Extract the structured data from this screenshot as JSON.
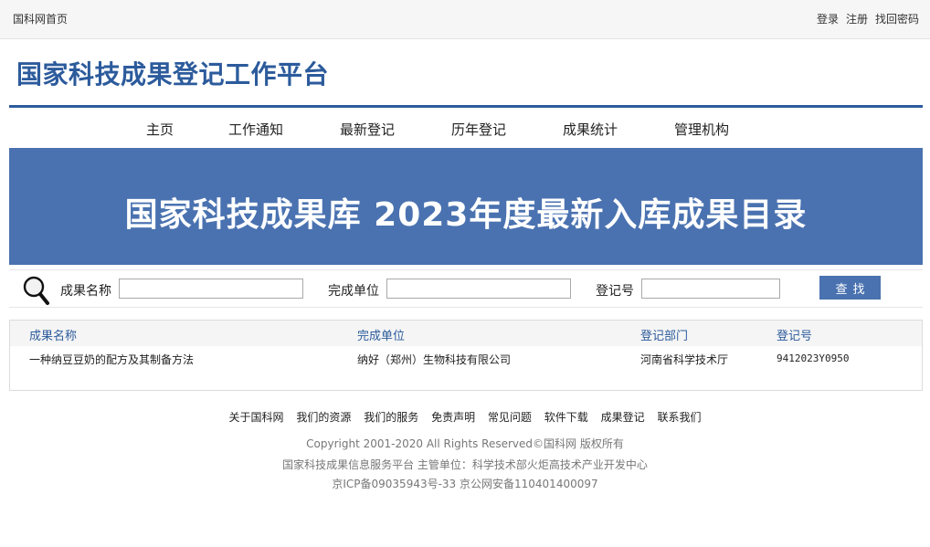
{
  "topbar": {
    "home": "国科网首页",
    "login": "登录",
    "register": "注册",
    "recover": "找回密码"
  },
  "header": {
    "title": "国家科技成果登记工作平台"
  },
  "nav": {
    "items": [
      "主页",
      "工作通知",
      "最新登记",
      "历年登记",
      "成果统计",
      "管理机构"
    ]
  },
  "banner": {
    "title": "国家科技成果库 2023年度最新入库成果目录"
  },
  "search": {
    "label_name": "成果名称",
    "label_unit": "完成单位",
    "label_reg": "登记号",
    "value_name": "",
    "value_unit": "",
    "value_reg": "",
    "button": "查找"
  },
  "results": {
    "headers": [
      "成果名称",
      "完成单位",
      "登记部门",
      "登记号"
    ],
    "rows": [
      [
        "一种纳豆豆奶的配方及其制备方法",
        "纳好（郑州）生物科技有限公司",
        "河南省科学技术厅",
        "9412023Y0950"
      ]
    ]
  },
  "footer": {
    "links": [
      "关于国科网",
      "我们的资源",
      "我们的服务",
      "免责声明",
      "常见问题",
      "软件下载",
      "成果登记",
      "联系我们"
    ],
    "copyright": "Copyright 2001-2020 All Rights Reserved©国科网 版权所有",
    "platform": "国家科技成果信息服务平台 主管单位：科学技术部火炬高技术产业开发中心",
    "icp": "京ICP备09035943号-33 京公网安备110401400097"
  },
  "colors": {
    "brand": "#2c5b9c",
    "banner": "#4a72b0"
  }
}
